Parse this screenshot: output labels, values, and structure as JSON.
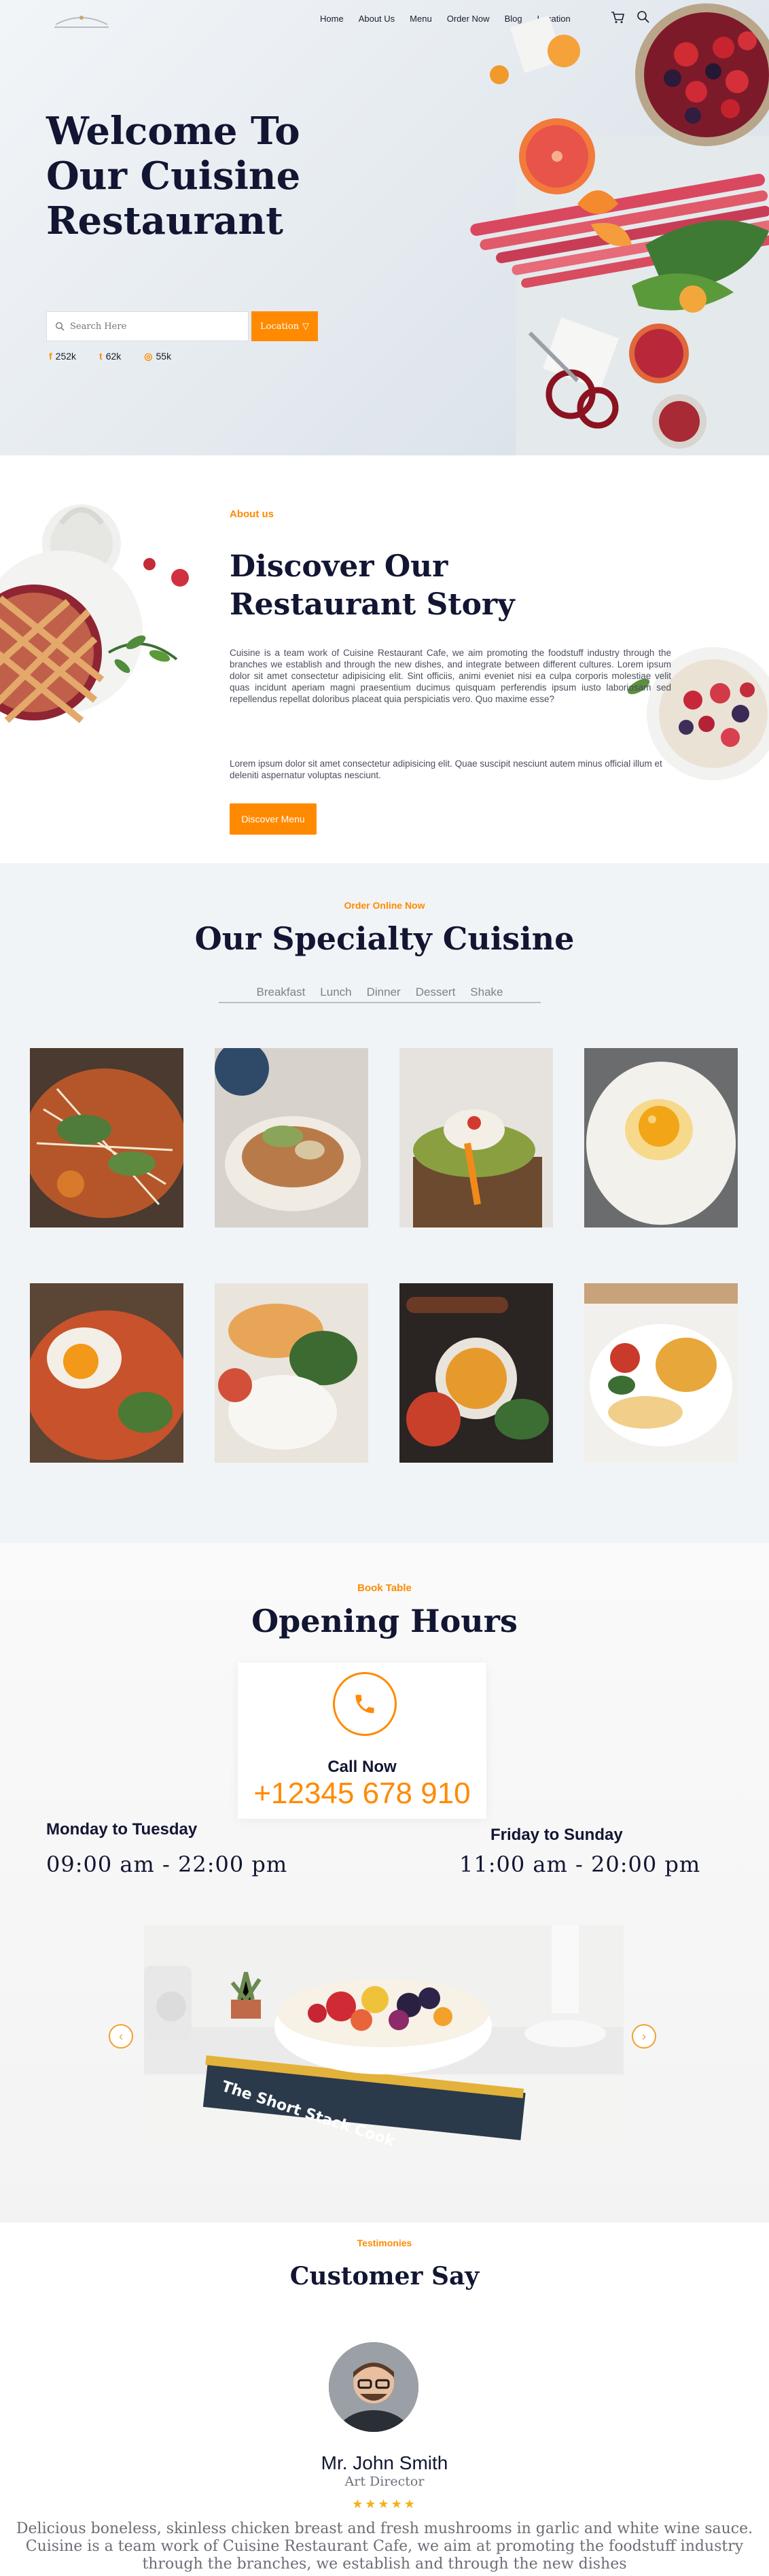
{
  "nav": {
    "items": [
      "Home",
      "About Us",
      "Menu",
      "Order Now",
      "Blog",
      "Location"
    ]
  },
  "hero": {
    "title": "Welcome To Our Cuisine Restaurant",
    "search_placeholder": "Search Here",
    "location_label": "Location",
    "social": [
      {
        "icon": "facebook-icon",
        "glyph": "f",
        "count": "252k"
      },
      {
        "icon": "twitter-icon",
        "glyph": "t",
        "count": "62k"
      },
      {
        "icon": "instagram-icon",
        "glyph": "◎",
        "count": "55k"
      }
    ]
  },
  "about": {
    "eyebrow": "About us",
    "title": "Discover Our Restaurant Story",
    "paragraph1": "Cuisine is a team work of Cuisine Restaurant Cafe, we aim promoting the foodstuff industry through the branches we establish and through the new dishes, and integrate between different cultures. Lorem ipsum dolor sit amet consectetur adipisicing elit. Sint officiis, animi eveniet nisi ea culpa corporis molestiae velit quas incidunt aperiam magni praesentium ducimus quisquam perferendis ipsum iusto laboriosam sed repellendus repellat doloribus placeat quia perspiciatis vero. Quo maxime esse?",
    "paragraph2": "Lorem ipsum dolor sit amet consectetur adipisicing elit. Quae suscipit nesciunt autem minus official illum et deleniti aspernatur voluptas nesciunt.",
    "button": "Discover Menu"
  },
  "specialty": {
    "eyebrow": "Order Online Now",
    "title": "Our Specialty Cuisine",
    "tabs": [
      "Breakfast",
      "Lunch",
      "Dinner",
      "Dessert",
      "Shake"
    ]
  },
  "hours": {
    "eyebrow": "Book Table",
    "title": "Opening Hours",
    "call_label": "Call Now",
    "phone": "+12345 678 910",
    "left_days": "Monday to Tuesday",
    "left_time": "09:00 am - 22:00 pm",
    "right_days": "Friday to Sunday",
    "right_time": "11:00 am - 20:00 pm",
    "book_spine_text": "The Short Stack Cook"
  },
  "testimonials": {
    "eyebrow": "Testimonies",
    "title": "Customer Say",
    "name": "Mr. John Smith",
    "role": "Art Director",
    "rating": 5,
    "stars": "★★★★★",
    "quote": "Delicious boneless, skinless chicken breast and fresh mushrooms in garlic and white wine sauce. Cuisine is a team work of Cuisine Restaurant Cafe, we aim at promoting the foodstuff industry through the branches, we establish and through the new dishes"
  },
  "colors": {
    "accent": "#ff8a00",
    "heading": "#121633",
    "hero_bg": "#e3e9ee",
    "section_bg": "#f1f4f6"
  }
}
